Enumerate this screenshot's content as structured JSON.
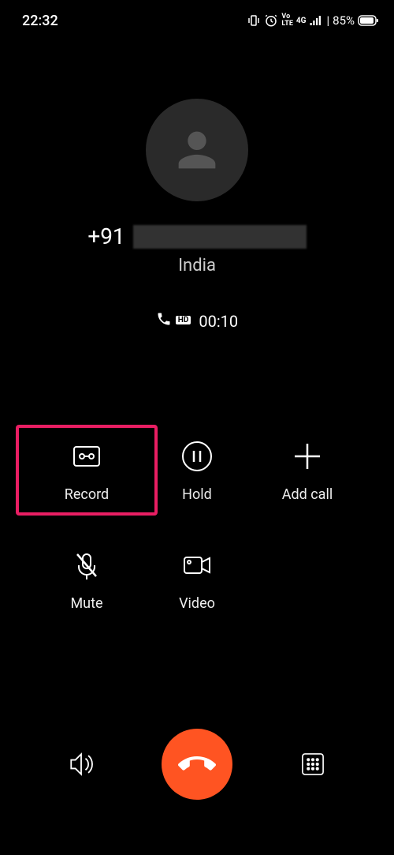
{
  "status_bar": {
    "time": "22:32",
    "battery_percent": "85%"
  },
  "call": {
    "country_code": "+91",
    "location": "India",
    "duration": "00:10"
  },
  "buttons": {
    "record": "Record",
    "hold": "Hold",
    "add_call": "Add call",
    "mute": "Mute",
    "video": "Video"
  }
}
